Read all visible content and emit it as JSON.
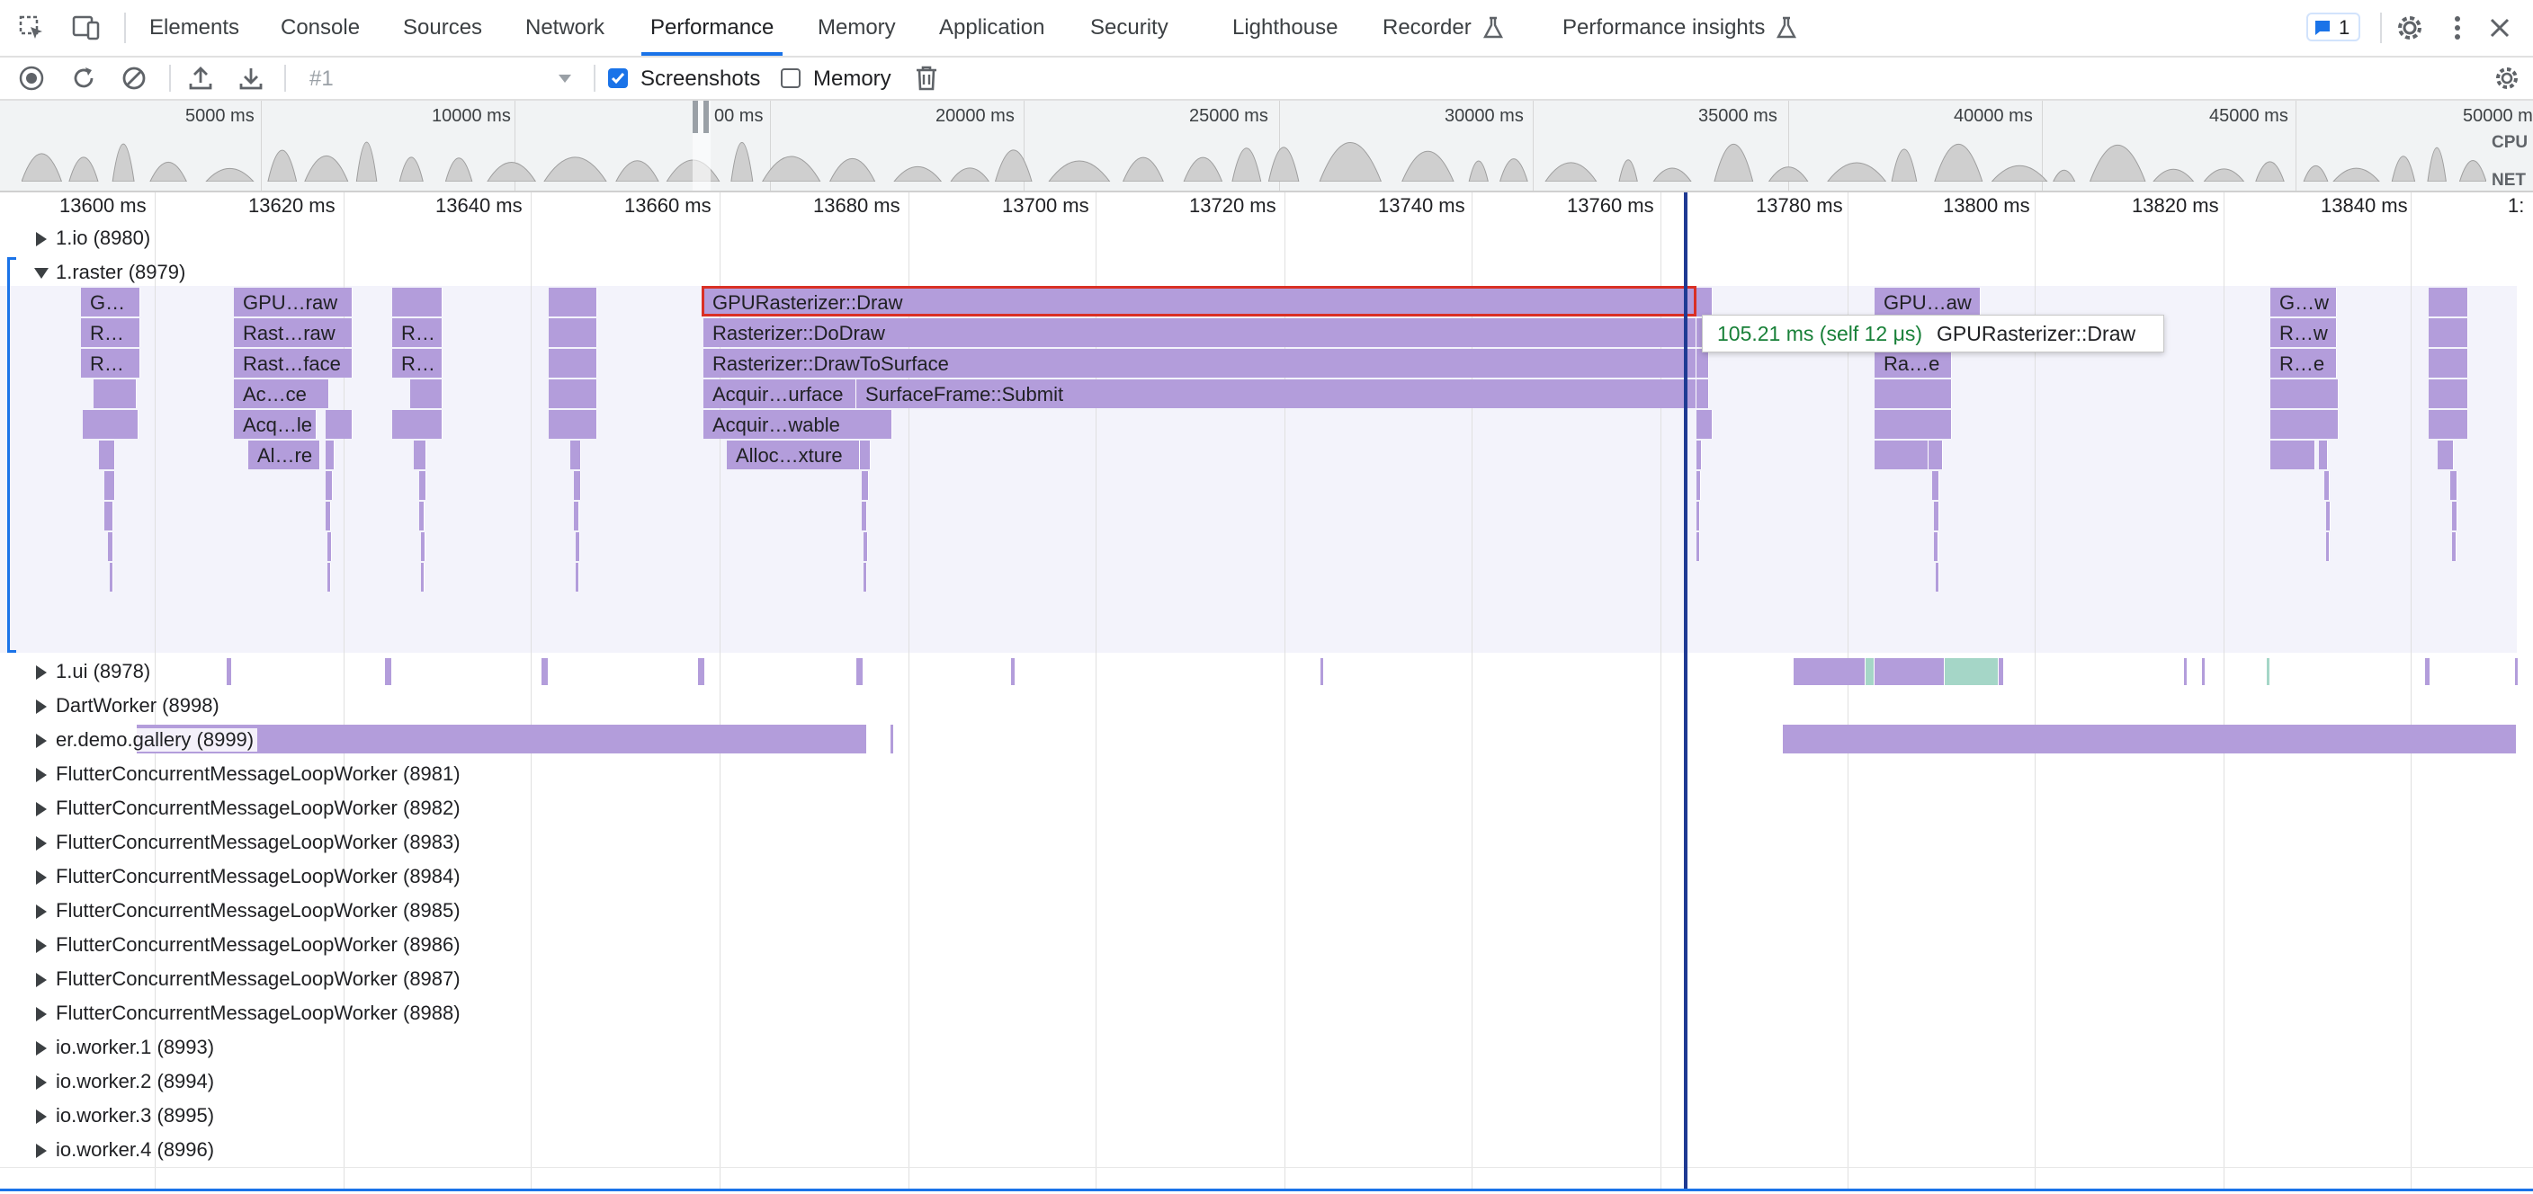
{
  "tabs": [
    {
      "label": "Elements"
    },
    {
      "label": "Console"
    },
    {
      "label": "Sources"
    },
    {
      "label": "Network"
    },
    {
      "label": "Performance",
      "active": true
    },
    {
      "label": "Memory"
    },
    {
      "label": "Application"
    },
    {
      "label": "Security"
    },
    {
      "label": "Lighthouse"
    },
    {
      "label": "Recorder"
    },
    {
      "label": "Performance insights"
    }
  ],
  "header": {
    "issues_count": "1"
  },
  "toolbar": {
    "profile_select": "#1",
    "screenshots_label": "Screenshots",
    "screenshots_checked": true,
    "memory_label": "Memory",
    "memory_checked": false
  },
  "overview": {
    "ticks": [
      "5000 ms",
      "10000 ms",
      "00 ms",
      "20000 ms",
      "25000 ms",
      "30000 ms",
      "35000 ms",
      "40000 ms",
      "45000 ms",
      "50000 ms"
    ],
    "cpu_label": "CPU",
    "net_label": "NET"
  },
  "ruler": {
    "ticks": [
      "13600 ms",
      "13620 ms",
      "13640 ms",
      "13660 ms",
      "13680 ms",
      "13700 ms",
      "13720 ms",
      "13740 ms",
      "13760 ms",
      "13780 ms",
      "13800 ms",
      "13820 ms",
      "13840 ms",
      "1:"
    ]
  },
  "tracks": [
    {
      "name": "1.io (8980)",
      "expanded": false
    },
    {
      "name": "1.raster (8979)",
      "expanded": true
    },
    {
      "name": "1.ui (8978)",
      "expanded": false
    },
    {
      "name": "DartWorker (8998)",
      "expanded": false
    },
    {
      "name": "er.demo.gallery (8999)",
      "expanded": false
    },
    {
      "name": "FlutterConcurrentMessageLoopWorker (8981)",
      "expanded": false
    },
    {
      "name": "FlutterConcurrentMessageLoopWorker (8982)",
      "expanded": false
    },
    {
      "name": "FlutterConcurrentMessageLoopWorker (8983)",
      "expanded": false
    },
    {
      "name": "FlutterConcurrentMessageLoopWorker (8984)",
      "expanded": false
    },
    {
      "name": "FlutterConcurrentMessageLoopWorker (8985)",
      "expanded": false
    },
    {
      "name": "FlutterConcurrentMessageLoopWorker (8986)",
      "expanded": false
    },
    {
      "name": "FlutterConcurrentMessageLoopWorker (8987)",
      "expanded": false
    },
    {
      "name": "FlutterConcurrentMessageLoopWorker (8988)",
      "expanded": false
    },
    {
      "name": "io.worker.1 (8993)",
      "expanded": false
    },
    {
      "name": "io.worker.2 (8994)",
      "expanded": false
    },
    {
      "name": "io.worker.3 (8995)",
      "expanded": false
    },
    {
      "name": "io.worker.4 (8996)",
      "expanded": false
    }
  ],
  "flames": {
    "g1": [
      "G…",
      "R…",
      "R…"
    ],
    "g2": [
      "GPU…raw",
      "Rast…raw",
      "Rast…face",
      "Ac…ce",
      "Acq…le",
      "Al…re"
    ],
    "g3": [
      "R…",
      "R…"
    ],
    "main": [
      "GPURasterizer::Draw",
      "Rasterizer::DoDraw",
      "Rasterizer::DrawToSurface",
      "Acquir…urface",
      "SurfaceFrame::Submit",
      "Acquir…wable",
      "Alloc…xture"
    ],
    "g5": [
      "GPU…aw",
      "Ra…e"
    ],
    "g6": [
      "G…w",
      "R…w",
      "R…e"
    ]
  },
  "tooltip": {
    "duration": "105.21 ms (self 12 μs)",
    "name": "GPURasterizer::Draw"
  },
  "colors": {
    "flame": "#b39ddb",
    "flame_green": "#a5d6c7",
    "accent": "#1a73e8",
    "selection": "#d93025"
  }
}
